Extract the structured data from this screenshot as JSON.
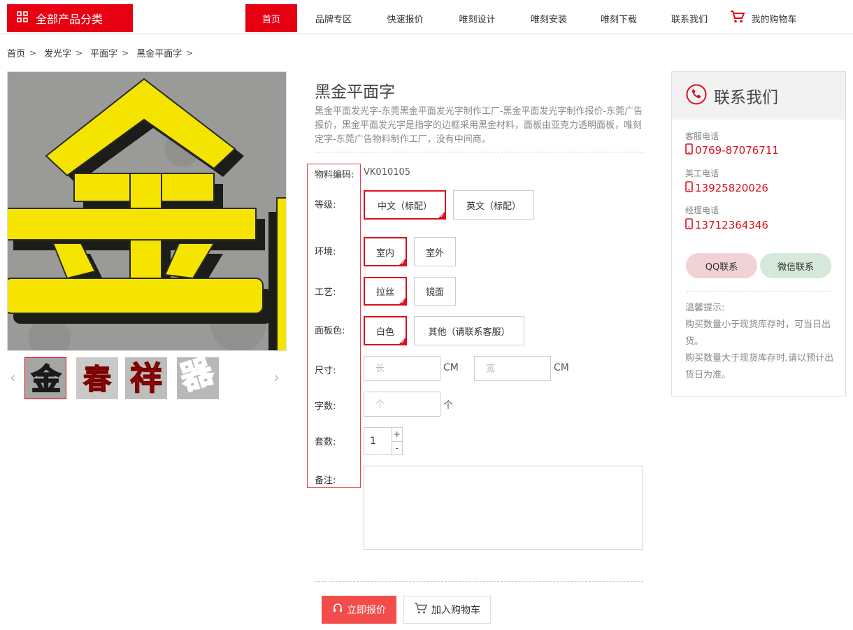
{
  "header": {
    "category_button": "全部产品分类",
    "nav": [
      {
        "label": "首页",
        "active": true
      },
      {
        "label": "品牌专区"
      },
      {
        "label": "快速报价"
      },
      {
        "label": "唯刻设计"
      },
      {
        "label": "唯刻安装"
      },
      {
        "label": "唯刻下载"
      },
      {
        "label": "联系我们"
      }
    ],
    "cart_label": "我的购物车"
  },
  "breadcrumb": [
    "首页",
    "发光字",
    "平面字",
    "黑金平面字"
  ],
  "gallery": {
    "main_image": {
      "character": "金",
      "face_color": "#f5e400",
      "edge_color": "#1a1a1a",
      "ground_color": "#9a9a98"
    },
    "thumbnails": [
      {
        "character": "金",
        "fill": "#f5e400"
      },
      {
        "character": "春",
        "fill": "#e11a1a"
      },
      {
        "character": "祥",
        "fill": "#e11a1a"
      },
      {
        "character": "器",
        "fill": "#1740b8"
      }
    ]
  },
  "product": {
    "title": "黑金平面字",
    "description": "黑金平面发光字-东莞黑金平面发光字制作工厂-黑金平面发光字制作报价-东莞广告报价，黑金平面发光字是指字的边框采用黑金材料，面板由亚克力透明面板，唯刻定字-东莞广告物料制作工厂，没有中间商。",
    "code_label": "物料编码:",
    "code_value": "VK010105",
    "grade": {
      "label": "等级:",
      "options": [
        "中文（标配）",
        "英文（标配）"
      ],
      "selected": 0
    },
    "environment": {
      "label": "环境:",
      "options": [
        "室内",
        "室外"
      ],
      "selected": 0
    },
    "craft": {
      "label": "工艺:",
      "options": [
        "拉丝",
        "镜面"
      ],
      "selected": 0
    },
    "panel_color": {
      "label": "面板色:",
      "options": [
        "白色",
        "其他（请联系客服）"
      ],
      "selected": 0
    },
    "size": {
      "label": "尺寸:",
      "length_placeholder": "长",
      "width_placeholder": "宽",
      "unit": "CM"
    },
    "char_count": {
      "label": "字数:",
      "placeholder": "个",
      "unit": "个"
    },
    "sets": {
      "label": "套数:",
      "value": "1",
      "plus": "+",
      "minus": "-"
    },
    "remark": {
      "label": "备注:"
    },
    "quote_button": "立即报价",
    "cart_button": "加入购物车"
  },
  "contact": {
    "title": "联系我们",
    "phones": [
      {
        "label": "客服电话",
        "number": "0769-87076711"
      },
      {
        "label": "美工电话",
        "number": "13925820026"
      },
      {
        "label": "经理电话",
        "number": "13712364346"
      }
    ],
    "qq_button": "QQ联系",
    "wechat_button": "微信联系",
    "tips": [
      "温馨提示:",
      "购买数量小于现货库存时，可当日出货。",
      "购买数量大于现货库存时,请以预计出货日为准。"
    ]
  },
  "colors": {
    "brand_red": "#e60012",
    "quote_red": "#f24d4b",
    "phone_red": "#d9111f"
  }
}
